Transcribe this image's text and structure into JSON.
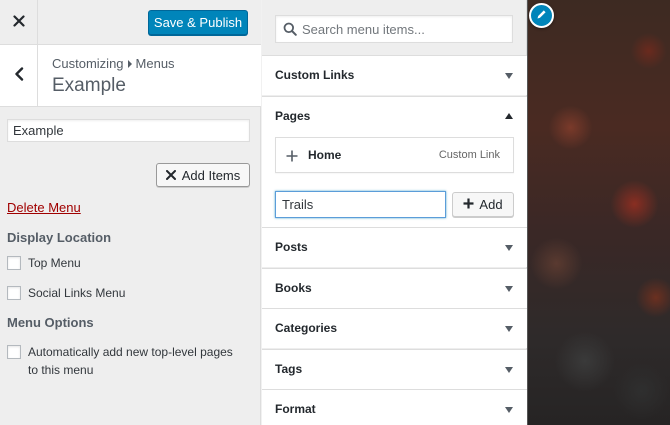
{
  "header": {
    "publish_label": "Save & Publish"
  },
  "section": {
    "breadcrumb_parent": "Customizing",
    "breadcrumb_current": "Menus",
    "title": "Example"
  },
  "menu": {
    "name_value": "Example",
    "add_items_label": "Add Items",
    "delete_label": "Delete Menu",
    "display_location_title": "Display Location",
    "locations": [
      {
        "label": "Top Menu",
        "checked": false
      },
      {
        "label": "Social Links Menu",
        "checked": false
      }
    ],
    "options_title": "Menu Options",
    "auto_add_line1": "Automatically add new top-level pages",
    "auto_add_line2": "to this menu"
  },
  "available_items": {
    "search_placeholder": "Search menu items...",
    "sections": [
      {
        "title": "Custom Links",
        "expanded": false
      },
      {
        "title": "Pages",
        "expanded": true
      },
      {
        "title": "Posts",
        "expanded": false
      },
      {
        "title": "Books",
        "expanded": false
      },
      {
        "title": "Categories",
        "expanded": false
      },
      {
        "title": "Tags",
        "expanded": false
      },
      {
        "title": "Format",
        "expanded": false
      }
    ],
    "pages": {
      "items": [
        {
          "title": "Home",
          "type": "Custom Link"
        }
      ],
      "new_page_value": "Trails",
      "add_label": "Add"
    }
  },
  "colors": {
    "primary_button": "#0085ba",
    "delete_link": "#a00000",
    "panel_bg": "#eeeeee"
  },
  "icons": {
    "close": "close-icon",
    "back": "chevron-left-icon",
    "add_items": "close-icon",
    "search": "search-icon",
    "page_add": "plus-icon",
    "add_page": "plus-icon",
    "edit_shortcut": "pencil-icon"
  }
}
